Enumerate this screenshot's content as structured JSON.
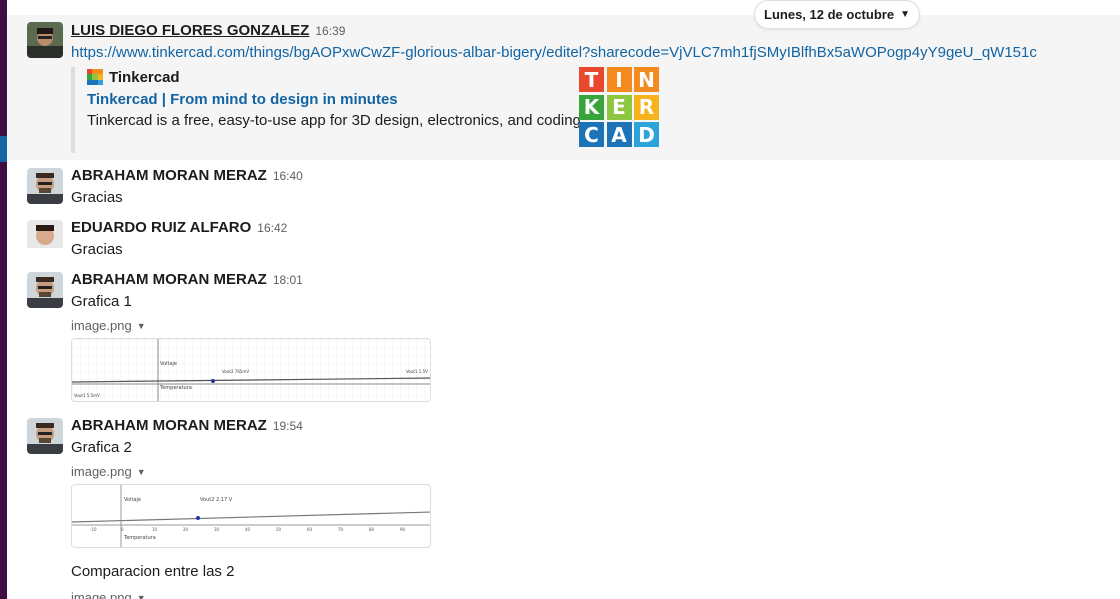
{
  "date_divider": {
    "label": "Lunes, 12 de octubre",
    "chevron": "chevron-down-icon"
  },
  "messages": [
    {
      "sender": "LUIS DIEGO FLORES GONZALEZ",
      "time": "16:39",
      "link": "https://www.tinkercad.com/things/bgAOPxwCwZF-glorious-albar-bigery/editel?sharecode=VjVLC7mh1fjSMyIBlfhBx5aWOPogp4yY9geU_qW151c",
      "unfurl": {
        "site": "Tinkercad",
        "title": "Tinkercad | From mind to design in minutes",
        "description": "Tinkercad is a free, easy-to-use app for 3D design, electronics, and coding.",
        "logo_letters": [
          "T",
          "I",
          "N",
          "K",
          "E",
          "R",
          "C",
          "A",
          "D"
        ],
        "logo_colors": [
          "#e8492e",
          "#f58a1f",
          "#f58a1f",
          "#37a53b",
          "#8ec63f",
          "#f6b31b",
          "#1d73b8",
          "#1d73b8",
          "#2da3dc"
        ]
      }
    },
    {
      "sender": "ABRAHAM MORAN MERAZ",
      "time": "16:40",
      "text": "Gracias"
    },
    {
      "sender": "EDUARDO RUIZ ALFARO",
      "time": "16:42",
      "text": "Gracias"
    },
    {
      "sender": "ABRAHAM MORAN MERAZ",
      "time": "18:01",
      "text": "Grafica 1",
      "file": "image.png",
      "thumb_labels": {
        "ylabel": "Voltaje",
        "xlabel": "Temperatura",
        "point": "Vout2 765mV",
        "edge": "Vout1 1.5V",
        "corner": "Vout1 5.5mV"
      }
    },
    {
      "sender": "ABRAHAM MORAN MERAZ",
      "time": "19:54",
      "text": "Grafica 2",
      "file": "image.png",
      "thumb_labels": {
        "ylabel": "Voltaje",
        "xlabel": "Temperatura",
        "point": "Vout2 2.17 V",
        "ticks": [
          "-10",
          "0",
          "10",
          "20",
          "30",
          "40",
          "50",
          "60",
          "70",
          "80",
          "90",
          "100"
        ]
      },
      "text2": "Comparacion entre las 2",
      "file2": "image.png"
    }
  ],
  "colors": {
    "link": "#1264a3",
    "sidebar": "#3f0e40",
    "highlight_bg": "#f5f5f5"
  }
}
